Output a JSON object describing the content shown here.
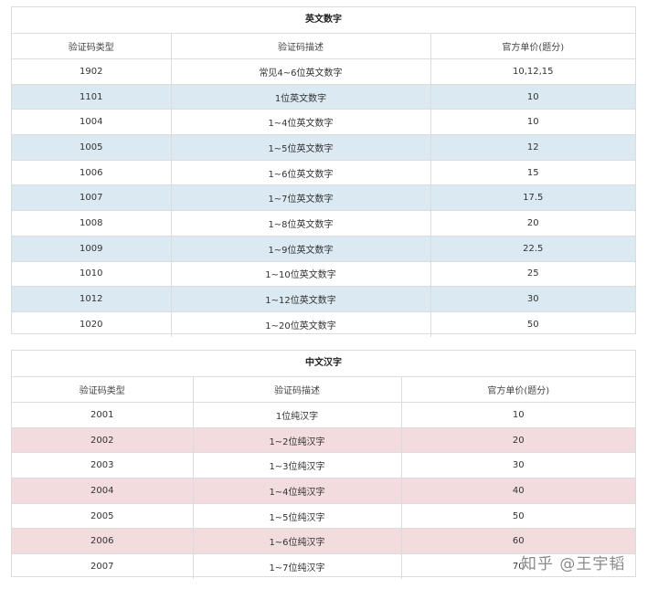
{
  "tables": {
    "english": {
      "title": "英文数字",
      "headers": [
        "验证码类型",
        "验证码描述",
        "官方单价(题分)"
      ],
      "rows": [
        [
          "1902",
          "常见4~6位英文数字",
          "10,12,15"
        ],
        [
          "1101",
          "1位英文数字",
          "10"
        ],
        [
          "1004",
          "1~4位英文数字",
          "10"
        ],
        [
          "1005",
          "1~5位英文数字",
          "12"
        ],
        [
          "1006",
          "1~6位英文数字",
          "15"
        ],
        [
          "1007",
          "1~7位英文数字",
          "17.5"
        ],
        [
          "1008",
          "1~8位英文数字",
          "20"
        ],
        [
          "1009",
          "1~9位英文数字",
          "22.5"
        ],
        [
          "1010",
          "1~10位英文数字",
          "25"
        ],
        [
          "1012",
          "1~12位英文数字",
          "30"
        ],
        [
          "1020",
          "1~20位英文数字",
          "50"
        ]
      ],
      "stripe_color": "#dbe9f2"
    },
    "chinese": {
      "title": "中文汉字",
      "headers": [
        "验证码类型",
        "验证码描述",
        "官方单价(题分)"
      ],
      "rows": [
        [
          "2001",
          "1位纯汉字",
          "10"
        ],
        [
          "2002",
          "1~2位纯汉字",
          "20"
        ],
        [
          "2003",
          "1~3位纯汉字",
          "30"
        ],
        [
          "2004",
          "1~4位纯汉字",
          "40"
        ],
        [
          "2005",
          "1~5位纯汉字",
          "50"
        ],
        [
          "2006",
          "1~6位纯汉字",
          "60"
        ],
        [
          "2007",
          "1~7位纯汉字",
          "70"
        ]
      ],
      "stripe_color": "#f2dcdd"
    }
  },
  "watermark": "知乎 @王宇韬"
}
